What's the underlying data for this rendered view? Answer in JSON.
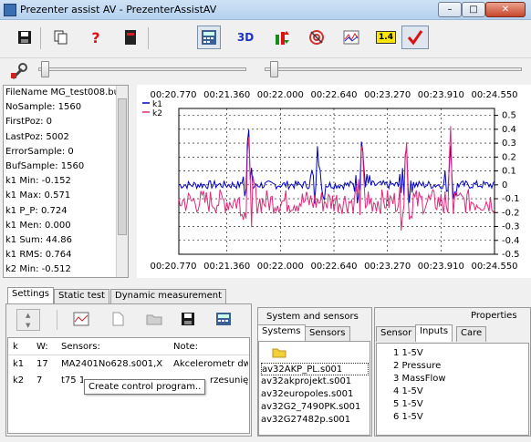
{
  "window": {
    "title": "Prezenter assist AV - PrezenterAssistAV",
    "minimize": "–",
    "maximize": "□",
    "close": "✕"
  },
  "toolbar": {
    "buttons": [
      {
        "icon": "save-icon"
      },
      {
        "icon": "copy-icon"
      },
      {
        "icon": "help-icon"
      },
      {
        "icon": "device-icon"
      },
      {
        "icon": "calculator-icon"
      },
      {
        "label": "3D"
      },
      {
        "icon": "bars-updown-icon"
      },
      {
        "icon": "target-icon"
      },
      {
        "icon": "chart-icon"
      },
      {
        "label": "1.4"
      },
      {
        "icon": "checkmark-icon"
      }
    ]
  },
  "info": {
    "rows": [
      "FileName MG_test008.bu",
      "NoSample: 1560",
      "FirstPoz: 0",
      "LastPoz: 5002",
      "ErrorSample: 0",
      "BufSample: 1560",
      "k1 Min:  -0.152",
      "k1 Max:  0.571",
      "k1 P_P:  0.724",
      "k1 Men:  0.000",
      "k1 Sum:  44.86",
      "k1 RMS:  0.764",
      "k2 Min:  -0.512",
      "k2 Max:  0.521"
    ]
  },
  "chart_data": {
    "type": "line",
    "x_tick_labels": [
      "00:20.770",
      "00:21.360",
      "00:22.000",
      "00:22.640",
      "00:23.270",
      "00:23.910",
      "00:24.550"
    ],
    "y_ticks": [
      0.5,
      0.4,
      0.3,
      0.2,
      0.1,
      0,
      -0.1,
      -0.2,
      -0.3,
      -0.4,
      -0.5
    ],
    "ylim": [
      -0.5,
      0.55
    ],
    "grid": true,
    "legend_position": "top-left",
    "series": [
      {
        "name": "k1",
        "color": "#0000c8",
        "baseline": 0.0,
        "noise": 0.03,
        "peaks": [
          [
            0.22,
            0.57
          ],
          [
            0.44,
            0.33
          ],
          [
            0.58,
            0.44
          ],
          [
            0.72,
            0.38
          ],
          [
            0.86,
            0.33
          ]
        ]
      },
      {
        "name": "k2",
        "color": "#e0287a",
        "baseline": -0.12,
        "noise": 0.09,
        "peaks": [
          [
            0.22,
            0.52
          ],
          [
            0.58,
            0.45
          ],
          [
            0.72,
            0.5
          ],
          [
            0.86,
            0.5
          ]
        ]
      }
    ]
  },
  "settings": {
    "tabs": [
      "Settings",
      "Static test",
      "Dynamic measurement"
    ],
    "columns": [
      "k",
      "W:",
      "Sensors:",
      "Note:"
    ],
    "rows": [
      {
        "k": "k1",
        "w": "17",
        "sensor": "MA2401No628.s001,X",
        "note": "Akcelerometr dwu"
      },
      {
        "k": "k2",
        "w": "7",
        "sensor": "t75 1",
        "note": "rzesunięc"
      }
    ],
    "tooltip": "Create control program.."
  },
  "systems": {
    "header": "System and sensors",
    "tabs": [
      "Systems",
      "Sensors"
    ],
    "items": [
      "av32AKP_PL.s001",
      "av32akprojekt.s001",
      "av32europoles.s001",
      "av32G2_7490PK.s001",
      "av32G27482p.s001"
    ]
  },
  "properties": {
    "header": "Properties",
    "tabs": [
      "Sensor",
      "Inputs",
      "Care"
    ],
    "items": [
      "1 1-5V",
      "2 Pressure",
      "3 MassFlow",
      "4 1-5V",
      "5 1-5V",
      "6 1-5V"
    ]
  }
}
